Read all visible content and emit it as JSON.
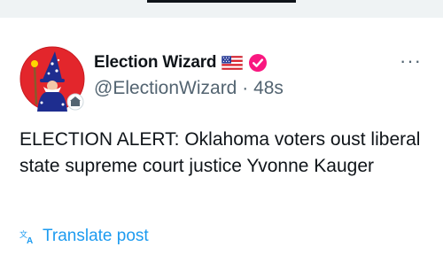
{
  "account": {
    "name": "Election Wizard",
    "handle": "@ElectionWizard",
    "time_sep": "·",
    "time": "48s",
    "verified_color": "#f91880",
    "flag_icon": "us-flag-icon"
  },
  "post": {
    "text": "ELECTION ALERT: Oklahoma voters oust liberal state supreme court justice Yvonne Kauger"
  },
  "actions": {
    "more_label": "···",
    "translate_label": "Translate post",
    "translate_icon": "translate-icon"
  },
  "colors": {
    "link": "#1d9bf0",
    "muted": "#536471",
    "avatar_bg": "#e3262c"
  }
}
